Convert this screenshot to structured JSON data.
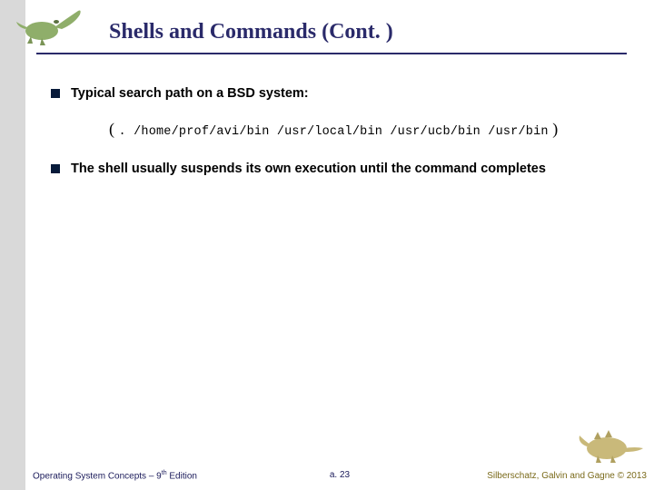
{
  "title": "Shells and Commands (Cont. )",
  "bullets": [
    {
      "text": "Typical search path on a BSD system:"
    },
    {
      "text": "The shell usually suspends its own execution until the command completes"
    }
  ],
  "path": {
    "open": "( ",
    "mono": ". /home/prof/avi/bin /usr/local/bin /usr/ucb/bin /usr/bin",
    "close": " )"
  },
  "footer": {
    "left_prefix": "Operating System Concepts – 9",
    "left_sup": "th",
    "left_suffix": " Edition",
    "center": "a. 23",
    "right": "Silberschatz, Galvin and Gagne © 2013"
  }
}
